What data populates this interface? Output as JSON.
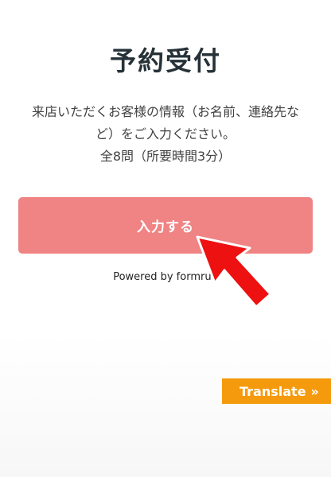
{
  "form": {
    "title": "予約受付",
    "description_lines": [
      "来店いただくお客様の情報（お名前、連絡先な",
      "ど）をご入力ください。",
      "全8問（所要時間3分）"
    ],
    "submit_label": "入力する",
    "powered_by": "Powered by formrun"
  },
  "translate": {
    "label": "Translate",
    "chevron": "»"
  },
  "icons": {
    "pointer_arrow": "red-arrow-icon"
  },
  "colors": {
    "title": "#263238",
    "button": "#f08383",
    "translate": "#f59a0c",
    "arrow": "#ee1111"
  }
}
